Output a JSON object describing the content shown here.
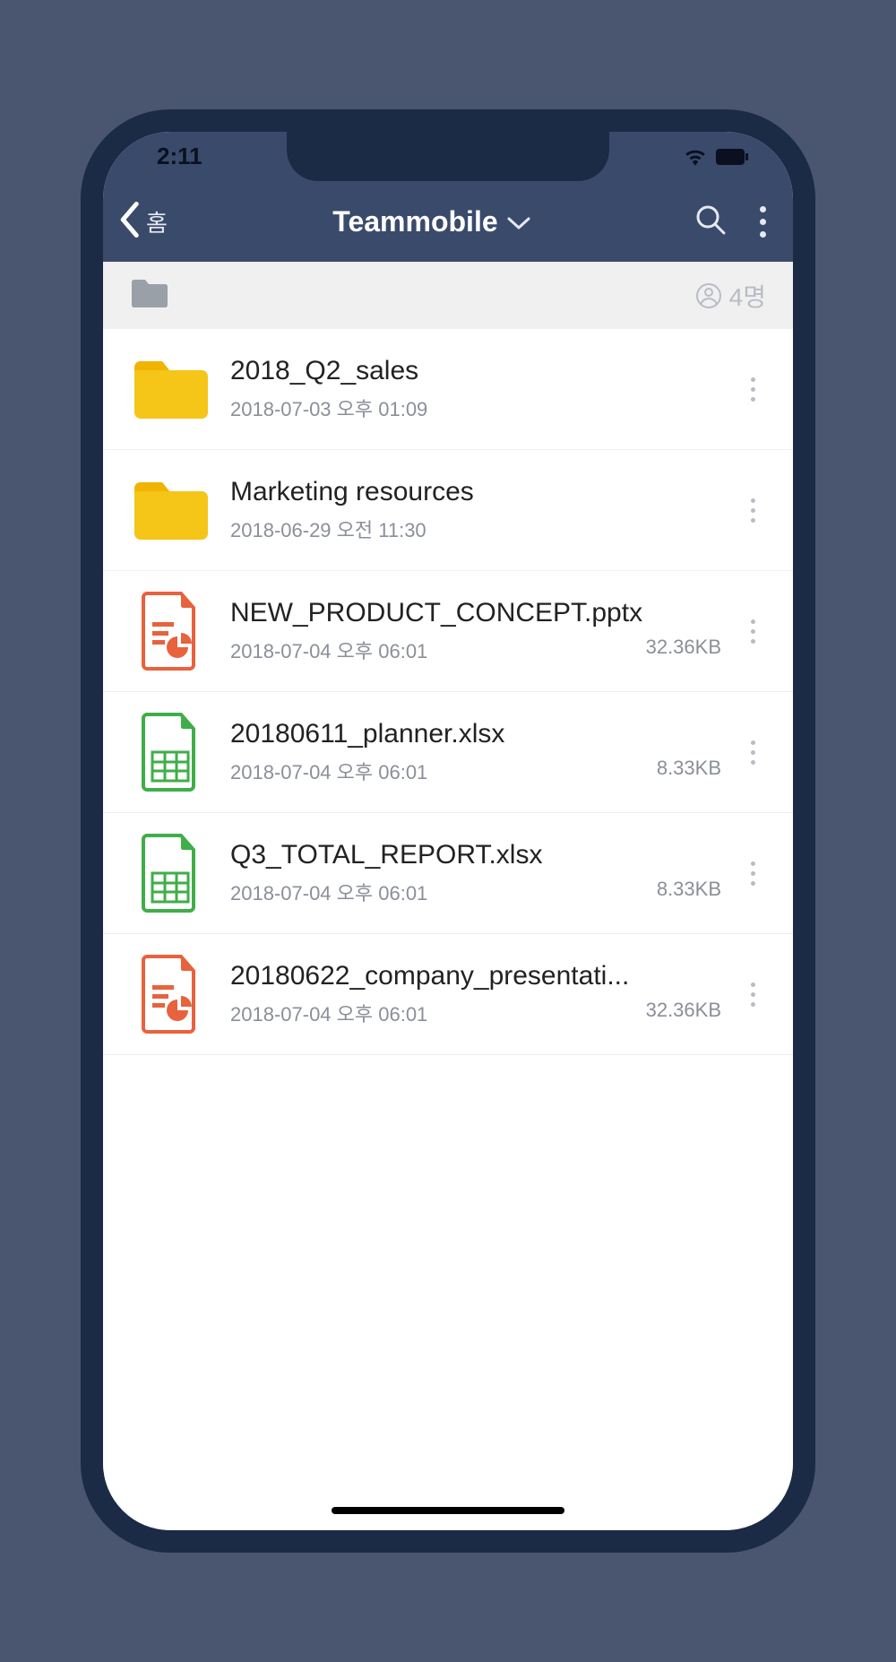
{
  "status": {
    "time": "2:11"
  },
  "nav": {
    "back_label": "홈",
    "title": "Teammobile"
  },
  "breadcrumb": {
    "members": "4명"
  },
  "items": [
    {
      "type": "folder",
      "name": "2018_Q2_sales",
      "date": "2018-07-03 오후 01:09",
      "size": ""
    },
    {
      "type": "folder",
      "name": "Marketing resources",
      "date": "2018-06-29 오전 11:30",
      "size": ""
    },
    {
      "type": "pptx",
      "name": "NEW_PRODUCT_CONCEPT.pptx",
      "date": "2018-07-04 오후 06:01",
      "size": "32.36KB"
    },
    {
      "type": "xlsx",
      "name": "20180611_planner.xlsx",
      "date": "2018-07-04 오후 06:01",
      "size": "8.33KB"
    },
    {
      "type": "xlsx",
      "name": "Q3_TOTAL_REPORT.xlsx",
      "date": "2018-07-04 오후 06:01",
      "size": "8.33KB"
    },
    {
      "type": "pptx",
      "name": "20180622_company_presentati...",
      "date": "2018-07-04 오후 06:01",
      "size": "32.36KB"
    }
  ]
}
